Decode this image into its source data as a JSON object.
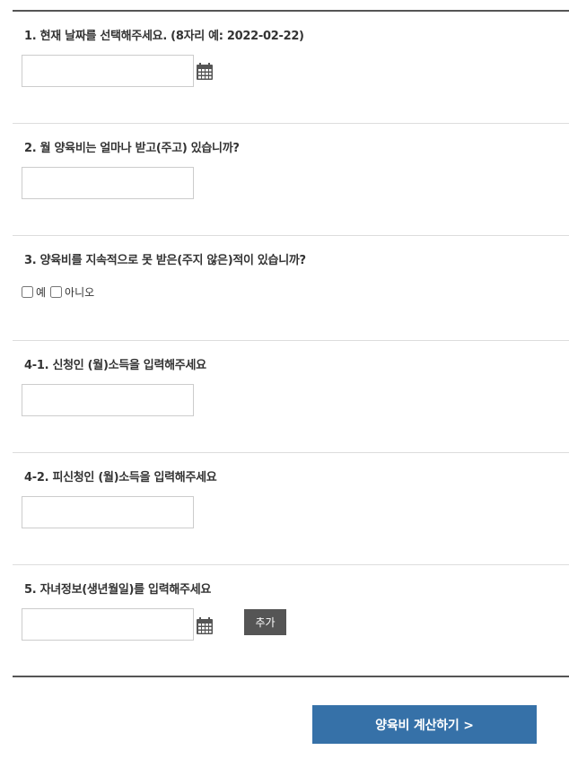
{
  "questions": {
    "q1": {
      "label": "1. 현재 날짜를 선택해주세요. (8자리 예: 2022-02-22)",
      "value": "",
      "placeholder": ""
    },
    "q2": {
      "label": "2. 월 양육비는 얼마나 받고(주고) 있습니까?",
      "value": "",
      "placeholder": ""
    },
    "q3": {
      "label": "3. 양육비를 지속적으로 못 받은(주지 않은)적이 있습니까?",
      "options": [
        "예",
        "아니오"
      ]
    },
    "q4_1": {
      "label": "4-1. 신청인 (월)소득을 입력해주세요",
      "value": "",
      "placeholder": ""
    },
    "q4_2": {
      "label": "4-2. 피신청인 (월)소득을 입력해주세요",
      "value": "",
      "placeholder": ""
    },
    "q5": {
      "label": "5. 자녀정보(생년월일)를 입력해주세요",
      "value": "",
      "placeholder": "",
      "add_label": "추가"
    }
  },
  "submit": {
    "label": "양육비 계산하기 >"
  },
  "icons": {
    "calendar": "calendar-icon"
  },
  "colors": {
    "submit_bg": "#3671a8",
    "add_bg": "#555555",
    "rule": "#555555"
  }
}
